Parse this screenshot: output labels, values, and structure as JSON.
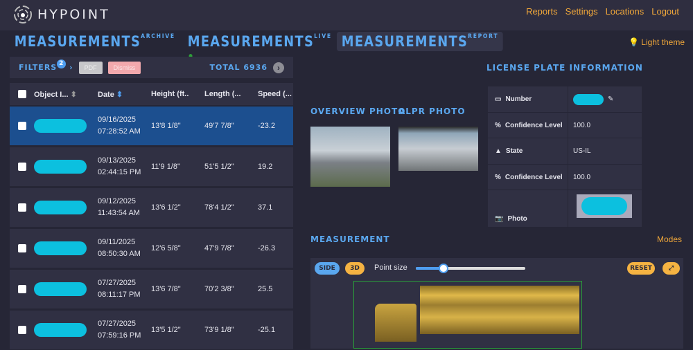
{
  "header": {
    "brand": "HYPOINT",
    "nav": [
      "Reports",
      "Settings",
      "Locations",
      "Logout"
    ]
  },
  "tabs": [
    {
      "title": "MEASUREMENTS",
      "sup": "ARCHIVE"
    },
    {
      "title": "MEASUREMENTS",
      "sup": "LIVE"
    },
    {
      "title": "MEASUREMENTS",
      "sup": "REPORT"
    }
  ],
  "theme_toggle": "Light theme",
  "filters": {
    "label": "FILTERS",
    "count": "2",
    "pdf": "PDF",
    "dismiss": "Dismiss",
    "total": "TOTAL 6936"
  },
  "table": {
    "columns": [
      "Object I...",
      "Date",
      "Height (ft..",
      "Length (...",
      "Speed (..."
    ],
    "rows": [
      {
        "date": "09/16/2025",
        "time": "07:28:52 AM",
        "height": "13'8 1/8\"",
        "length": "49'7 7/8\"",
        "speed": "-23.2"
      },
      {
        "date": "09/13/2025",
        "time": "02:44:15 PM",
        "height": "11'9 1/8\"",
        "length": "51'5 1/2\"",
        "speed": "19.2"
      },
      {
        "date": "09/12/2025",
        "time": "11:43:54 AM",
        "height": "13'6 1/2\"",
        "length": "78'4 1/2\"",
        "speed": "37.1"
      },
      {
        "date": "09/11/2025",
        "time": "08:50:30 AM",
        "height": "12'6 5/8\"",
        "length": "47'9 7/8\"",
        "speed": "-26.3"
      },
      {
        "date": "07/27/2025",
        "time": "08:11:17 PM",
        "height": "13'6 7/8\"",
        "length": "70'2 3/8\"",
        "speed": "25.5"
      },
      {
        "date": "07/27/2025",
        "time": "07:59:16 PM",
        "height": "13'5 1/2\"",
        "length": "73'9 1/8\"",
        "speed": "-25.1"
      }
    ]
  },
  "photos": {
    "overview": "OVERVIEW PHOTO",
    "alpr": "ALPR PHOTO"
  },
  "license": {
    "title": "LICENSE PLATE INFORMATION",
    "rows": [
      {
        "label": "Number",
        "value": ""
      },
      {
        "label": "Confidence Level",
        "value": "100.0"
      },
      {
        "label": "State",
        "value": "US-IL"
      },
      {
        "label": "Confidence Level",
        "value": "100.0"
      },
      {
        "label": "Photo",
        "value": ""
      }
    ]
  },
  "measurement": {
    "title": "MEASUREMENT",
    "modes": "Modes",
    "side": "SIDE",
    "three_d": "3D",
    "point_size_label": "Point size",
    "point_size": 0.25,
    "reset": "RESET"
  }
}
